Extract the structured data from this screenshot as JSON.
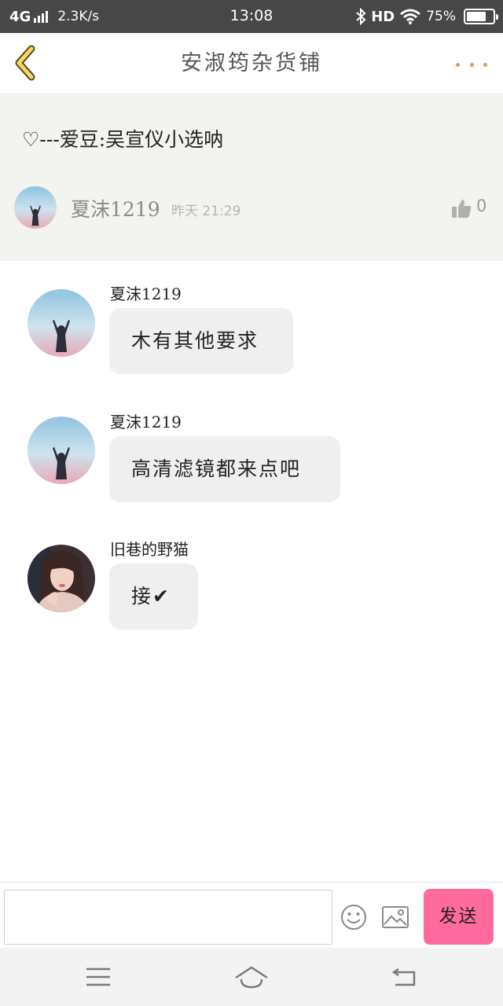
{
  "status_bar": {
    "network": "4G",
    "speed": "2.3K/s",
    "time": "13:08",
    "hd": "HD",
    "battery": "75%",
    "battery_level": 0.75
  },
  "header": {
    "title": "安淑筠杂货铺",
    "accent_color": "#e09a4a"
  },
  "post": {
    "title": "♡---爱豆:吴宣仪小选呐",
    "author": "夏沫1219",
    "time": "昨天 21:29",
    "likes": "0"
  },
  "messages": [
    {
      "name": "夏沫1219",
      "text": "木有其他要求",
      "avatar": "silhouette-avatar"
    },
    {
      "name": "夏沫1219",
      "text": "高清滤镜都来点吧",
      "avatar": "silhouette-avatar"
    },
    {
      "name": "旧巷的野猫",
      "text": "接✔",
      "avatar": "girl-portrait-avatar"
    }
  ],
  "input": {
    "placeholder": "",
    "value": "",
    "send_label": "发送",
    "send_color": "#ff6b9e"
  },
  "icons": {
    "back": "chevron-left-icon",
    "more": "more-dots-icon",
    "like": "thumbs-up-icon",
    "emoji": "smiley-icon",
    "image": "image-icon",
    "menu": "menu-icon",
    "home": "home-icon",
    "return": "return-icon"
  }
}
